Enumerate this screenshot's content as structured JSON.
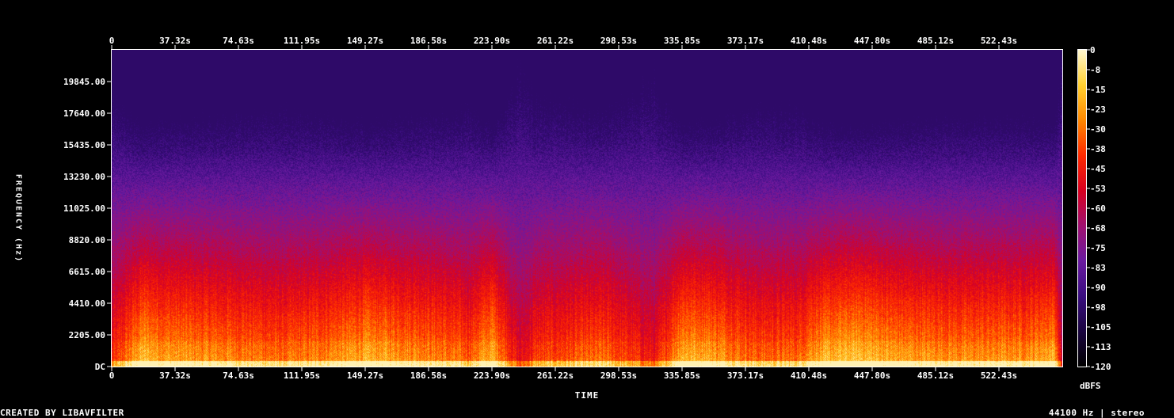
{
  "chart_data": {
    "type": "heatmap",
    "title": "",
    "xlabel": "TIME",
    "ylabel": "FREQUENCY (Hz)",
    "x_ticks": [
      "0",
      "37.32s",
      "74.63s",
      "111.95s",
      "149.27s",
      "186.58s",
      "223.90s",
      "261.22s",
      "298.53s",
      "335.85s",
      "373.17s",
      "410.48s",
      "447.80s",
      "485.12s",
      "522.43s"
    ],
    "x_tick_values": [
      0,
      37.32,
      74.63,
      111.95,
      149.27,
      186.58,
      223.9,
      261.22,
      298.53,
      335.85,
      373.17,
      410.48,
      447.8,
      485.12,
      522.43
    ],
    "xlim": [
      0,
      559.75
    ],
    "y_ticks": [
      "DC",
      "2205.00",
      "4410.00",
      "6615.00",
      "8820.00",
      "11025.00",
      "13230.00",
      "15435.00",
      "17640.00",
      "19845.00"
    ],
    "y_tick_values": [
      0,
      2205,
      4410,
      6615,
      8820,
      11025,
      13230,
      15435,
      17640,
      19845
    ],
    "ylim": [
      0,
      22050
    ],
    "colorbar": {
      "label": "dBFS",
      "ticks": [
        "0",
        "-8",
        "-15",
        "-23",
        "-30",
        "-38",
        "-45",
        "-53",
        "-60",
        "-68",
        "-75",
        "-83",
        "-90",
        "-98",
        "-105",
        "-113",
        "-120"
      ],
      "range": [
        -120,
        0
      ]
    },
    "colormap": [
      "#000000",
      "#1a0440",
      "#3a0d80",
      "#6a1aa0",
      "#a01070",
      "#d80020",
      "#ff2a00",
      "#ff8800",
      "#ffd030",
      "#fff8d0"
    ],
    "energy_profile": [
      {
        "t": 0,
        "v": 0.55
      },
      {
        "t": 18,
        "v": 0.92
      },
      {
        "t": 30,
        "v": 0.85
      },
      {
        "t": 60,
        "v": 0.8
      },
      {
        "t": 75,
        "v": 0.78
      },
      {
        "t": 100,
        "v": 0.72
      },
      {
        "t": 135,
        "v": 0.82
      },
      {
        "t": 150,
        "v": 0.88
      },
      {
        "t": 185,
        "v": 0.8
      },
      {
        "t": 210,
        "v": 0.7
      },
      {
        "t": 224,
        "v": 0.9
      },
      {
        "t": 240,
        "v": 0.45
      },
      {
        "t": 250,
        "v": 0.62
      },
      {
        "t": 290,
        "v": 0.72
      },
      {
        "t": 320,
        "v": 0.5
      },
      {
        "t": 335,
        "v": 0.9
      },
      {
        "t": 350,
        "v": 0.88
      },
      {
        "t": 380,
        "v": 0.7
      },
      {
        "t": 405,
        "v": 0.72
      },
      {
        "t": 412,
        "v": 0.85
      },
      {
        "t": 440,
        "v": 0.95
      },
      {
        "t": 460,
        "v": 0.85
      },
      {
        "t": 500,
        "v": 0.8
      },
      {
        "t": 540,
        "v": 0.82
      },
      {
        "t": 555,
        "v": 0.9
      },
      {
        "t": 559.75,
        "v": 0.3
      }
    ]
  },
  "footer": {
    "left": "CREATED BY LIBAVFILTER",
    "right": "44100 Hz | stereo"
  }
}
